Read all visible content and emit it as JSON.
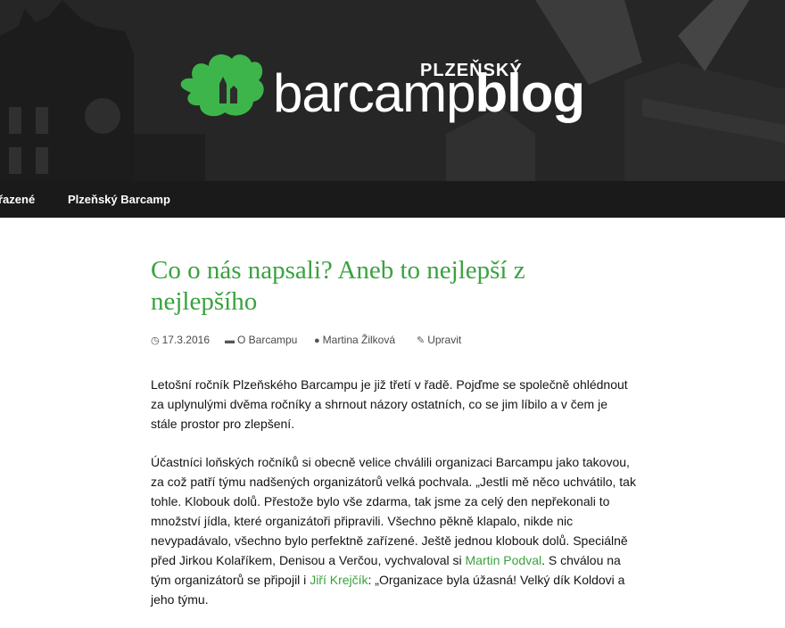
{
  "header": {
    "logo_small": "PLZEŇSKÝ",
    "logo_part1": "barcamp",
    "logo_part2": "blog"
  },
  "nav": {
    "items": [
      "řazené",
      "Plzeňský Barcamp"
    ]
  },
  "post": {
    "title": "Co o nás napsali? Aneb to nejlepší z nejlepšího",
    "date": "17.3.2016",
    "category": "O Barcampu",
    "author": "Martina Žilková",
    "edit": "Upravit",
    "p1": "Letošní ročník Plzeňského Barcampu je již třetí v řadě. Pojďme se společně ohlédnout za uplynulými dvěma ročníky a shrnout názory ostatních, co se jim líbilo a v čem je stále prostor pro zlepšení.",
    "p2_a": "Účastníci loňských ročníků si obecně velice chválili organizaci Barcampu jako takovou, za což patří týmu nadšených organizátorů velká pochvala. „Jestli mě něco uchvátilo, tak tohle. Klobouk dolů. Přestože bylo vše zdarma, tak jsme za celý den nepřekonali to množství jídla, které organizátoři připravili. Všechno pěkně klapalo, nikde nic nevypadávalo, všechno bylo perfektně zařízené. Ještě jednou klobouk dolů. Speciálně před Jirkou Kolaříkem, Denisou a Verčou, vychvaloval si ",
    "p2_link1": "Martin Podval",
    "p2_b": ". S chválou na tým organizátorů se připojil i ",
    "p2_link2": "Jiří Krejčík",
    "p2_c": ": „Organizace byla úžasná! Velký dík Koldovi a jeho týmu."
  },
  "colors": {
    "accent": "#3aa23f",
    "navbar": "#1a1a1a"
  }
}
